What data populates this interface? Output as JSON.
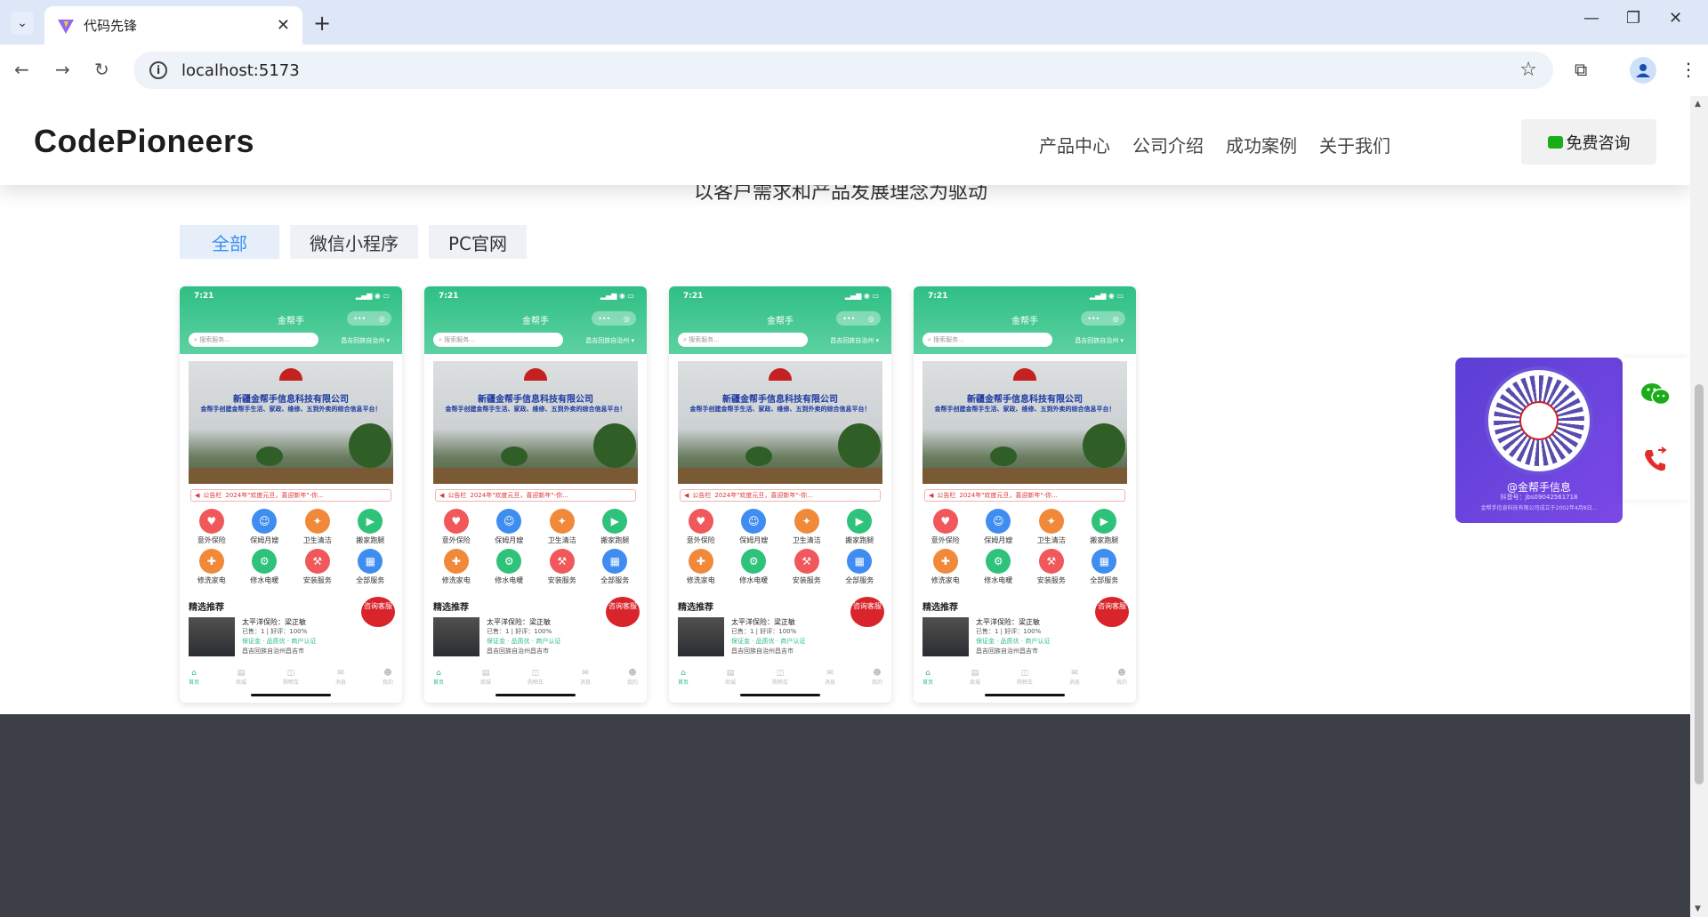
{
  "browser": {
    "tab_title": "代码先锋",
    "url": "localhost:5173"
  },
  "header": {
    "logo": "CodePioneers",
    "nav": [
      "产品中心",
      "公司介绍",
      "成功案例",
      "关于我们"
    ],
    "consult_button": "免费咨询"
  },
  "section": {
    "subtitle": "以客户需求和产品发展理念为驱动",
    "filters": [
      "全部",
      "微信小程序",
      "PC官网"
    ],
    "active_filter": "全部"
  },
  "card": {
    "time": "7:21",
    "app_title": "金帮手",
    "search_placeholder": "搜索服务...",
    "city": "昌吉回族自治州",
    "banner_company": "新疆金帮手信息科技有限公司",
    "banner_slogan": "金帮手创建金帮手生活、家政、维修、五到外卖的综合信息平台！",
    "notice_tag": "公告栏",
    "notice_text": "2024年\"欢度元旦，喜迎新年\"-你...",
    "services": [
      "意外保险",
      "保姆月嫂",
      "卫生清洁",
      "搬家跑腿",
      "修洗家电",
      "修水电暖",
      "安装服务",
      "全部服务"
    ],
    "section_title": "精选推荐",
    "kefu": "咨询客服",
    "listing_title": "太平洋保险：梁正敏",
    "listing_stats": "已售：1 | 好评：100%",
    "listing_tags": "保证金 · 品质优 · 商户认证",
    "listing_address": "昌吉回族自治州昌吉市",
    "tabs": [
      "首页",
      "商城",
      "购物车",
      "消息",
      "我的"
    ]
  },
  "cards_count": 4,
  "contact": {
    "name": "@金帮手信息",
    "account": "抖音号：jbs09042561718",
    "desc": "金帮手信息科技有限公司成立于2002年4月8日..."
  },
  "colors": {
    "brand_green": "#2fbf85",
    "accent_blue": "#3b8ff0",
    "footer": "#3c3f47",
    "qr_purple": "#6b52d8",
    "kefu_red": "#d8242a"
  }
}
